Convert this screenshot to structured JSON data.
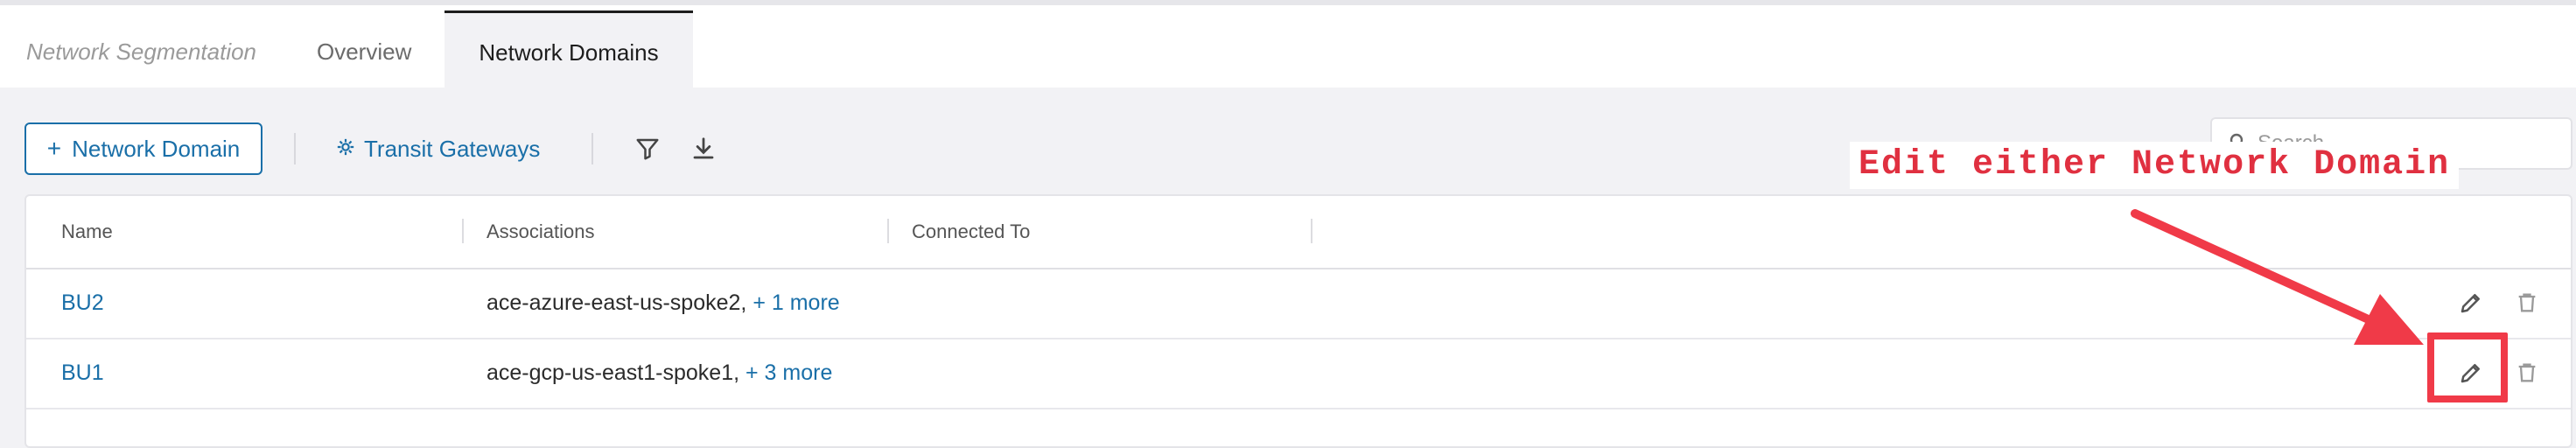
{
  "tabs": {
    "breadcrumb": "Network Segmentation",
    "overview": "Overview",
    "network_domains": "Network Domains"
  },
  "toolbar": {
    "add_label": "Network Domain",
    "add_icon": "+",
    "transit_label": "Transit Gateways",
    "filter_icon": "filter-icon",
    "download_icon": "download-icon"
  },
  "search": {
    "placeholder": "Search"
  },
  "table": {
    "columns": [
      "Name",
      "Associations",
      "Connected To"
    ],
    "rows": [
      {
        "name": "BU2",
        "association": "ace-azure-east-us-spoke2,",
        "more": "+ 1 more",
        "connected": ""
      },
      {
        "name": "BU1",
        "association": "ace-gcp-us-east1-spoke1,",
        "more": "+ 3 more",
        "connected": ""
      }
    ]
  },
  "annotation": {
    "text": "Edit either Network Domain",
    "color": "#f03a48"
  },
  "colors": {
    "accent": "#1a6fa8",
    "background": "#f2f2f5"
  }
}
